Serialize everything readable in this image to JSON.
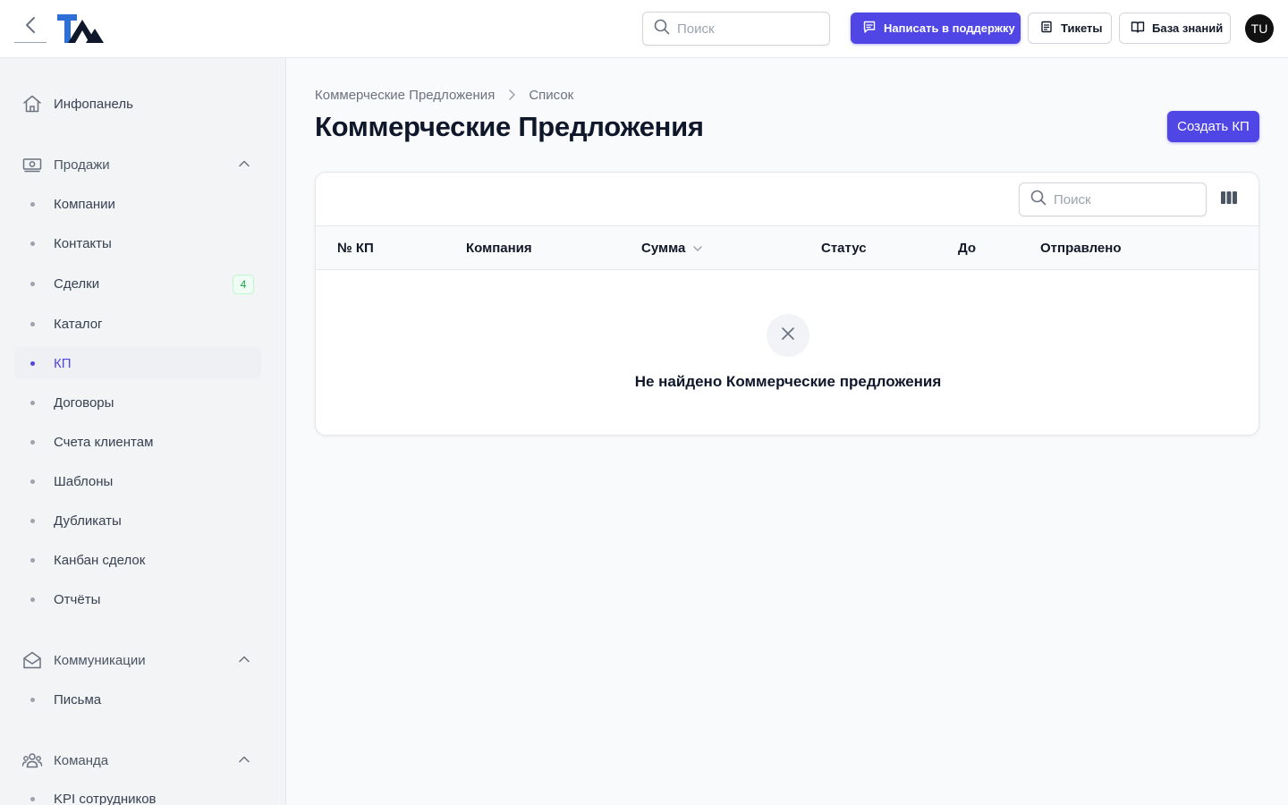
{
  "colors": {
    "accent": "#4f46e5",
    "badge_green": "#16a34a",
    "sidebar_bg": "#f3f4f6"
  },
  "header": {
    "logo_text": "TA",
    "search_placeholder": "Поиск",
    "support_label": "Написать в поддержку",
    "tickets_label": "Тикеты",
    "kb_label": "База знаний",
    "avatar_initials": "TU"
  },
  "sidebar": {
    "dashboard": "Инфопанель",
    "sales": {
      "label": "Продажи",
      "items": [
        {
          "label": "Компании"
        },
        {
          "label": "Контакты"
        },
        {
          "label": "Сделки",
          "badge": "4"
        },
        {
          "label": "Каталог"
        },
        {
          "label": "КП",
          "active": true
        },
        {
          "label": "Договоры"
        },
        {
          "label": "Счета клиентам"
        },
        {
          "label": "Шаблоны"
        },
        {
          "label": "Дубликаты"
        },
        {
          "label": "Канбан сделок"
        },
        {
          "label": "Отчёты"
        }
      ]
    },
    "communications": {
      "label": "Коммуникации",
      "items": [
        {
          "label": "Письма"
        }
      ]
    },
    "team": {
      "label": "Команда",
      "items": [
        {
          "label": "KPI сотрудников"
        }
      ]
    }
  },
  "main": {
    "breadcrumb": [
      "Коммерческие Предложения",
      "Список"
    ],
    "title": "Коммерческие Предложения",
    "create_button": "Создать КП",
    "table": {
      "search_placeholder": "Поиск",
      "columns": [
        "№ КП",
        "Компания",
        "Сумма",
        "Статус",
        "До",
        "Отправлено"
      ],
      "sorted_column": "Сумма",
      "rows": [],
      "empty_message": "Не найдено Коммерческие предложения"
    }
  }
}
